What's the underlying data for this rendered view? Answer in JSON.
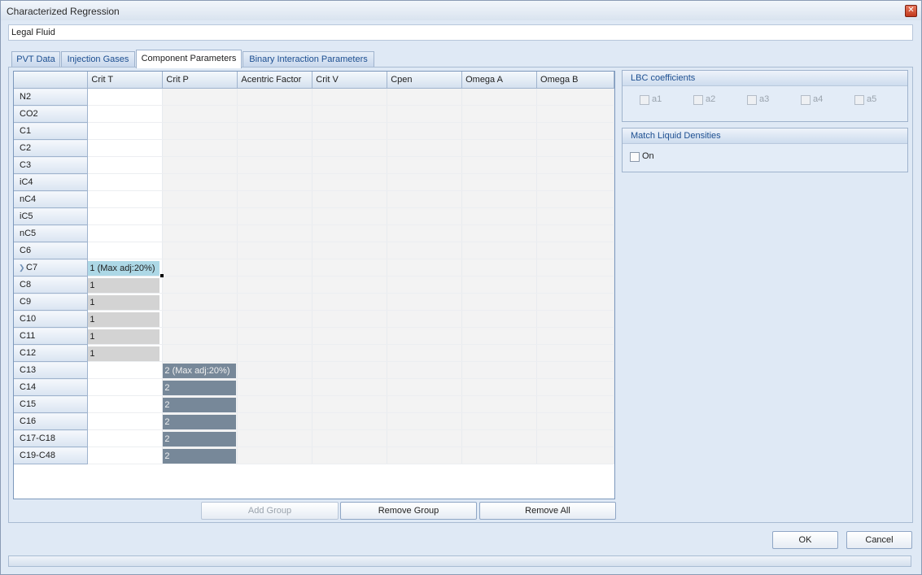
{
  "window": {
    "title": "Characterized Regression"
  },
  "fluid": {
    "name": "Legal Fluid"
  },
  "tabs": [
    {
      "label": "PVT Data"
    },
    {
      "label": "Injection Gases"
    },
    {
      "label": "Component Parameters"
    },
    {
      "label": "Binary Interaction Parameters"
    }
  ],
  "grid": {
    "columns": [
      "Crit T",
      "Crit P",
      "Acentric Factor",
      "Crit V",
      "Cpen",
      "Omega A",
      "Omega B"
    ],
    "rows": [
      {
        "name": "N2",
        "crit_t": "",
        "crit_p": ""
      },
      {
        "name": "CO2",
        "crit_t": "",
        "crit_p": ""
      },
      {
        "name": "C1",
        "crit_t": "",
        "crit_p": ""
      },
      {
        "name": "C2",
        "crit_t": "",
        "crit_p": ""
      },
      {
        "name": "C3",
        "crit_t": "",
        "crit_p": ""
      },
      {
        "name": "iC4",
        "crit_t": "",
        "crit_p": ""
      },
      {
        "name": "nC4",
        "crit_t": "",
        "crit_p": ""
      },
      {
        "name": "iC5",
        "crit_t": "",
        "crit_p": ""
      },
      {
        "name": "nC5",
        "crit_t": "",
        "crit_p": ""
      },
      {
        "name": "C6",
        "crit_t": "",
        "crit_p": ""
      },
      {
        "name": "C7",
        "crit_t": "1 (Max adj:20%)",
        "crit_p": "",
        "selected": true
      },
      {
        "name": "C8",
        "crit_t": "1",
        "crit_p": ""
      },
      {
        "name": "C9",
        "crit_t": "1",
        "crit_p": ""
      },
      {
        "name": "C10",
        "crit_t": "1",
        "crit_p": ""
      },
      {
        "name": "C11",
        "crit_t": "1",
        "crit_p": ""
      },
      {
        "name": "C12",
        "crit_t": "1",
        "crit_p": ""
      },
      {
        "name": "C13",
        "crit_t": "",
        "crit_p": "2 (Max adj:20%)"
      },
      {
        "name": "C14",
        "crit_t": "",
        "crit_p": "2"
      },
      {
        "name": "C15",
        "crit_t": "",
        "crit_p": "2"
      },
      {
        "name": "C16",
        "crit_t": "",
        "crit_p": "2"
      },
      {
        "name": "C17-C18",
        "crit_t": "",
        "crit_p": "2"
      },
      {
        "name": "C19-C48",
        "crit_t": "",
        "crit_p": "2"
      }
    ],
    "group_colors": {
      "group1": "#d3d3d3",
      "group1_selected": "#add8e6",
      "group2": "#778899"
    }
  },
  "grid_buttons": {
    "add_group": "Add Group",
    "remove_group": "Remove Group",
    "remove_all": "Remove All"
  },
  "lbc": {
    "title": "LBC coefficients",
    "options": [
      {
        "label": "a1",
        "checked": false
      },
      {
        "label": "a2",
        "checked": false
      },
      {
        "label": "a3",
        "checked": false
      },
      {
        "label": "a4",
        "checked": false
      },
      {
        "label": "a5",
        "checked": false
      }
    ]
  },
  "match": {
    "title": "Match Liquid Densities",
    "on_label": "On",
    "checked": false
  },
  "dialog_buttons": {
    "ok": "OK",
    "cancel": "Cancel"
  }
}
